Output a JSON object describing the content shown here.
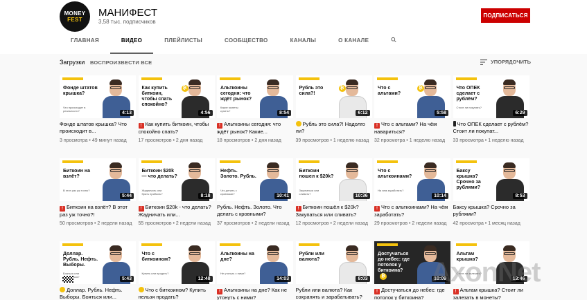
{
  "channel": {
    "avatar_line1": "MONEY",
    "avatar_line2": "FEST",
    "name": "МАНИФЕСТ",
    "subscribers": "3,58 тыс. подписчиков",
    "subscribe_label": "ПОДПИСАТЬСЯ"
  },
  "tabs": [
    "ГЛАВНАЯ",
    "ВИДЕО",
    "ПЛЕЙЛИСТЫ",
    "СООБЩЕСТВО",
    "КАНАЛЫ",
    "О КАНАЛЕ"
  ],
  "section": {
    "title": "Загрузки",
    "play_all": "ВОСПРОИЗВЕСТИ ВСЕ",
    "sort": "УПОРЯДОЧИТЬ"
  },
  "videos": [
    {
      "thumb_title": "Фонде штатов крышка?",
      "thumb_sub": "Что происходит в реальности?",
      "duration": "4:13",
      "badge": "",
      "title": "Фонде штатов крышка? Что происходит в...",
      "views": "3 просмотра",
      "age": "49 минут назад"
    },
    {
      "thumb_title": "Как купить биткоин, чтобы спать спокойно?",
      "thumb_sub": "",
      "duration": "4:56",
      "badge": "red",
      "title": "Как купить биткоин, чтобы спокойно спать?",
      "views": "17 просмотров",
      "age": "2 дня назад"
    },
    {
      "thumb_title": "Альткоины сегодня: что ждёт рынок?",
      "thumb_sub": "Какие монеты купить?",
      "duration": "8:54",
      "badge": "red",
      "title": "Альткоины сегодня: что ждёт рынок? Какие...",
      "views": "18 просмотров",
      "age": "2 дня назад"
    },
    {
      "thumb_title": "Рубль это сила?!",
      "thumb_sub": "",
      "duration": "6:12",
      "badge": "emoji",
      "title": "Рубль это сила?! Надолго ли?",
      "views": "39 просмотров",
      "age": "1 неделю назад"
    },
    {
      "thumb_title": "Что с альтами?",
      "thumb_sub": "",
      "duration": "5:58",
      "badge": "red",
      "title": "Что с альтами? На чём навариться?",
      "views": "32 просмотра",
      "age": "1 неделю назад"
    },
    {
      "thumb_title": "Что ОПЕК сделает с рублём?",
      "thumb_sub": "Стоит ли покупать?",
      "duration": "6:29",
      "badge": "phone",
      "title": "Что ОПЕК сделает с рублём? Стоит ли покупат...",
      "views": "33 просмотра",
      "age": "1 неделю назад"
    },
    {
      "thumb_title": "Биткоин на взлёт?",
      "thumb_sub": "В этот раз уж точно?",
      "duration": "5:44",
      "badge": "red",
      "title": "Биткоин на взлёт? В этот раз уж точно?!",
      "views": "50 просмотров",
      "age": "2 недели назад"
    },
    {
      "thumb_title": "Биткоин $20k — что делать?",
      "thumb_sub": "Жадничать или брать прибыль?",
      "duration": "8:18",
      "badge": "red",
      "title": "Биткоин $20k - что делать? Жадничать или...",
      "views": "55 просмотров",
      "age": "2 недели назад"
    },
    {
      "thumb_title": "Нефть. Золото. Рубль.",
      "thumb_sub": "Что делать с кровными?",
      "duration": "10:41",
      "badge": "",
      "title": "Рубль. Нефть. Золото. Что делать с кровными?",
      "views": "37 просмотров",
      "age": "2 недели назад"
    },
    {
      "thumb_title": "Биткоин пошел к $20k?",
      "thumb_sub": "Закупаться или сливать?",
      "duration": "10:36",
      "badge": "red",
      "title": "Биткоин пошёл к $20k? Закупаться или сливать?",
      "views": "12 просмотров",
      "age": "2 недели назад"
    },
    {
      "thumb_title": "Что с альткоинами?",
      "thumb_sub": "На чем заработать?",
      "duration": "10:14",
      "badge": "red",
      "title": "Что с альткоинами? На чём заработать?",
      "views": "29 просмотров",
      "age": "2 недели назад"
    },
    {
      "thumb_title": "Баксу крышка? Срочно за рублями?",
      "thumb_sub": "",
      "duration": "8:53",
      "badge": "",
      "title": "Баксу крышка? Срочно за рублями?",
      "views": "42 просмотра",
      "age": "1 месяц назад"
    },
    {
      "thumb_title": "Доллар. Рубль. Нефть. Выборы.",
      "thumb_sub": "Бояться или радоваться?",
      "duration": "5:43",
      "badge": "emoji",
      "title": "Доллар. Рубль. Нефть. Выборы. Бояться или...",
      "views": "",
      "age": ""
    },
    {
      "thumb_title": "Что с биткоином?",
      "thumb_sub": "Купить или продать?",
      "duration": "12:48",
      "badge": "emoji",
      "title": "Что с биткоином? Купить нельзя продать?",
      "views": "",
      "age": ""
    },
    {
      "thumb_title": "Альткоины на дне?",
      "thumb_sub": "Не утонуть с ними?",
      "duration": "14:03",
      "badge": "red",
      "title": "Альткоины на дне? Как не утонуть с ними?",
      "views": "",
      "age": ""
    },
    {
      "thumb_title": "Рубли или валюта?",
      "thumb_sub": "",
      "duration": "8:03",
      "badge": "",
      "title": "Рубли или валюта? Как сохранять и зарабатывать?",
      "views": "",
      "age": ""
    },
    {
      "thumb_title": "Достучаться до небес: где потолок у биткоина?",
      "thumb_sub": "",
      "duration": "10:09",
      "badge": "red",
      "title": "Достучаться до небес: где потолок у биткоина?",
      "views": "",
      "age": ""
    },
    {
      "thumb_title": "Альтам крышка?",
      "thumb_sub": "Стоит ли залезать?",
      "duration": "13:46",
      "badge": "red",
      "title": "Альтам крышка? Стоит ли залезать в монеты?",
      "views": "",
      "age": ""
    }
  ],
  "watermark": "AxonNet"
}
